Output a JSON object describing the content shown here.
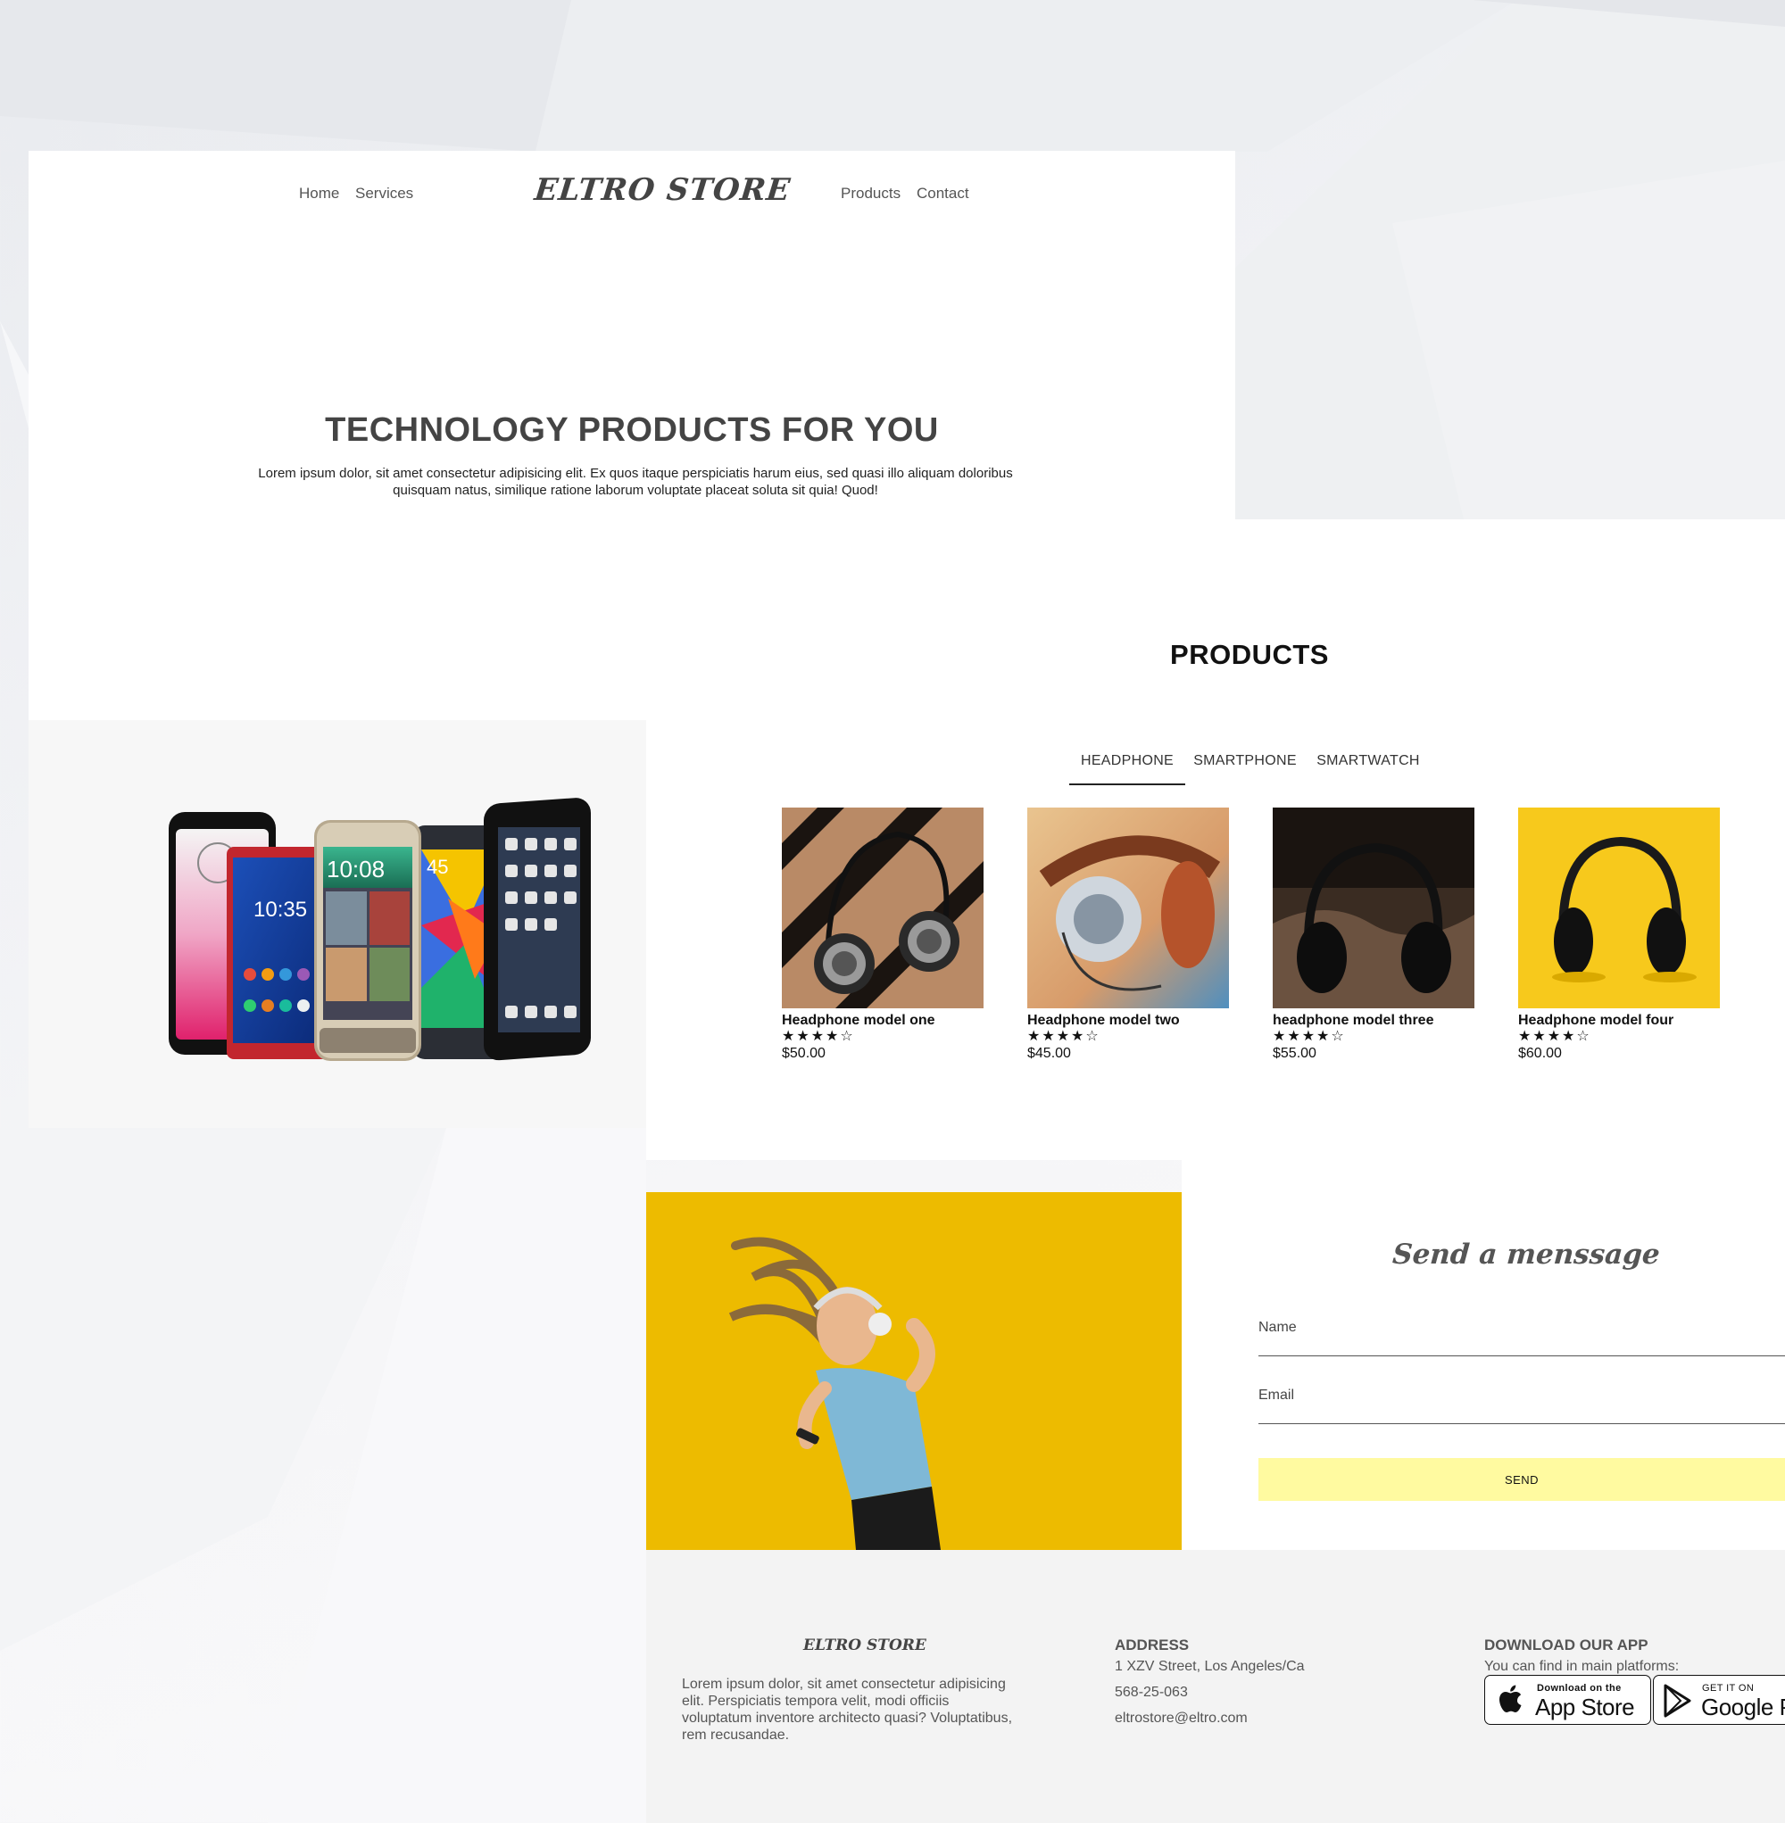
{
  "header": {
    "nav_left": [
      "Home",
      "Services"
    ],
    "brand": "ELTRO STORE",
    "nav_right": [
      "Products",
      "Contact"
    ]
  },
  "hero": {
    "title": "TECHNOLOGY PRODUCTS FOR YOU",
    "text": "Lorem ipsum dolor, sit amet consectetur adipisicing elit. Ex quos itaque perspiciatis harum eius, sed quasi illo aliquam doloribus quisquam natus, similique ratione laborum voluptate placeat soluta sit quia! Quod!"
  },
  "products": {
    "title": "PRODUCTS",
    "tabs": [
      "HEADPHONE",
      "SMARTPHONE",
      "SMARTWATCH"
    ],
    "active_tab": "HEADPHONE",
    "items": [
      {
        "name": "Headphone model one",
        "rating": 4,
        "stars": "★★★★☆",
        "price": "$50.00"
      },
      {
        "name": "Headphone model two",
        "rating": 4,
        "stars": "★★★★☆",
        "price": "$45.00"
      },
      {
        "name": "headphone model three",
        "rating": 4,
        "stars": "★★★★☆",
        "price": "$55.00"
      },
      {
        "name": "Headphone model four",
        "rating": 4,
        "stars": "★★★★☆",
        "price": "$60.00"
      }
    ]
  },
  "phone_screens": {
    "htc_time": "10:08",
    "sony_time": "10:35",
    "samsung_time": "45"
  },
  "message": {
    "title": "Send a menssage",
    "name_placeholder": "Name",
    "email_placeholder": "Email",
    "send_label": "SEND"
  },
  "footer": {
    "brand": "ELTRO STORE",
    "about": "Lorem ipsum dolor, sit amet consectetur adipisicing elit. Perspiciatis tempora velit, modi officiis voluptatum inventore architecto quasi? Voluptatibus, rem recusandae.",
    "address_heading": "ADDRESS",
    "address": "1 XZV Street, Los Angeles/Ca",
    "phone": "568-25-063",
    "email": "eltrostore@eltro.com",
    "app_heading": "DOWNLOAD OUR APP",
    "app_text": "You can find in main platforms:",
    "appstore_small": "Download on the",
    "appstore_big": "App Store",
    "googleplay_small": "GET IT ON",
    "googleplay_big": "Google Play"
  },
  "colors": {
    "send_button": "#fffaa0",
    "accent_yellow": "#f2c400",
    "footer_bg": "#f3f3f3",
    "phones_panel_bg": "#f7f7f7"
  }
}
